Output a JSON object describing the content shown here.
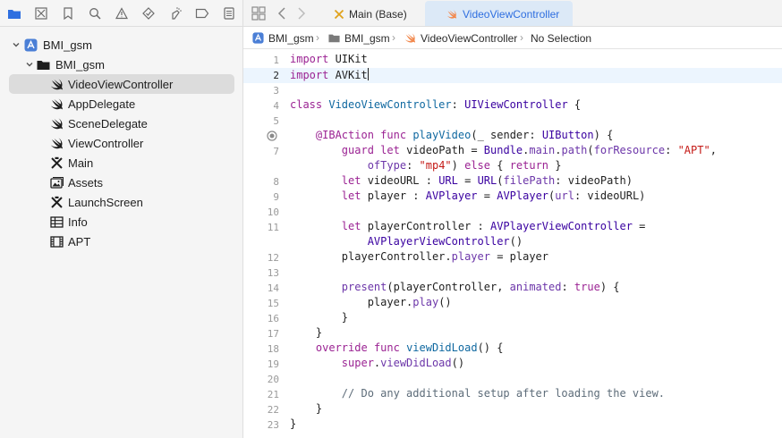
{
  "navigator": {
    "toolbar_icons": [
      "folder-icon",
      "source-control-icon",
      "bookmark-icon",
      "find-icon",
      "issue-warning-icon",
      "test-diamond-icon",
      "debug-spray-icon",
      "breakpoint-icon",
      "report-icon"
    ],
    "tree": [
      {
        "name": "BMI_gsm",
        "icon": "project-icon",
        "level": 0,
        "expanded": true
      },
      {
        "name": "BMI_gsm",
        "icon": "folder-icon",
        "level": 1,
        "expanded": true
      },
      {
        "name": "VideoViewController",
        "icon": "swift-icon",
        "level": 2,
        "selected": true
      },
      {
        "name": "AppDelegate",
        "icon": "swift-icon",
        "level": 2
      },
      {
        "name": "SceneDelegate",
        "icon": "swift-icon",
        "level": 2
      },
      {
        "name": "ViewController",
        "icon": "swift-icon",
        "level": 2
      },
      {
        "name": "Main",
        "icon": "storyboard-icon",
        "level": 2
      },
      {
        "name": "Assets",
        "icon": "asset-catalog-icon",
        "level": 2
      },
      {
        "name": "LaunchScreen",
        "icon": "storyboard-icon",
        "level": 2
      },
      {
        "name": "Info",
        "icon": "plist-table-icon",
        "level": 2
      },
      {
        "name": "APT",
        "icon": "video-film-icon",
        "level": 2
      }
    ]
  },
  "tabs": [
    {
      "label": "Main (Base)",
      "icon": "storyboard-icon",
      "active": false
    },
    {
      "label": "VideoViewController",
      "icon": "swift-icon",
      "active": true
    }
  ],
  "jumpbar": {
    "project": "BMI_gsm",
    "group": "BMI_gsm",
    "file": "VideoViewController",
    "symbol": "No Selection"
  },
  "editor": {
    "current_line": 2,
    "breakpoint_line": 6,
    "line_numbers": [
      "1",
      "2",
      "3",
      "4",
      "5",
      "6",
      "7",
      "",
      "8",
      "9",
      "10",
      "11",
      "",
      "12",
      "13",
      "14",
      "15",
      "16",
      "17",
      "18",
      "19",
      "20",
      "21",
      "22",
      "23"
    ],
    "code_lines": [
      "import UIKit",
      "import AVKit",
      "",
      "class VideoViewController: UIViewController {",
      "",
      "    @IBAction func playVideo(_ sender: UIButton) {",
      "        guard let videoPath = Bundle.main.path(forResource: \"APT\",",
      "            ofType: \"mp4\") else { return }",
      "        let videoURL : URL = URL(filePath: videoPath)",
      "        let player : AVPlayer = AVPlayer(url: videoURL)",
      "",
      "        let playerController : AVPlayerViewController =",
      "            AVPlayerViewController()",
      "        playerController.player = player",
      "",
      "        present(playerController, animated: true) {",
      "            player.play()",
      "        }",
      "    }",
      "    override func viewDidLoad() {",
      "        super.viewDidLoad()",
      "",
      "        // Do any additional setup after loading the view.",
      "    }",
      "}"
    ]
  }
}
